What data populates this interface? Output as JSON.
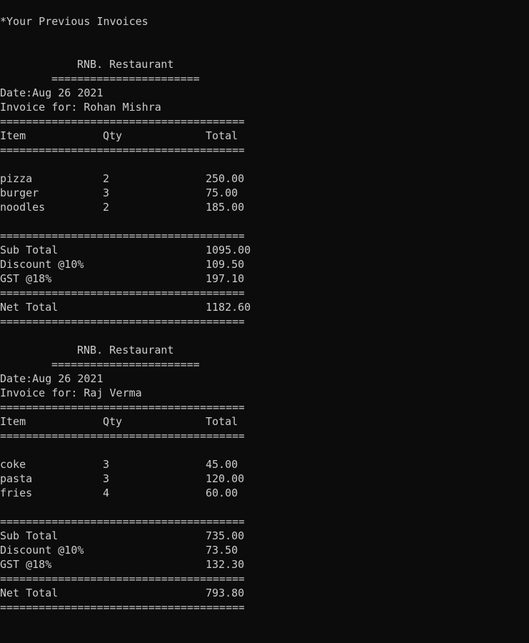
{
  "header": "*Your Previous Invoices",
  "rules": {
    "long": "======================================",
    "short": "======================="
  },
  "invoices": [
    {
      "restaurant": "RNB. Restaurant",
      "date": "Date:Aug 26 2021",
      "customer": "Invoice for: Rohan Mishra",
      "columns": [
        "Item",
        "Qty",
        "Total"
      ],
      "items": [
        {
          "name": "pizza",
          "qty": "2",
          "total": "250.00"
        },
        {
          "name": "burger",
          "qty": "3",
          "total": "75.00"
        },
        {
          "name": "noodles",
          "qty": "2",
          "total": "185.00"
        }
      ],
      "sub_total": {
        "label": "Sub Total",
        "value": "1095.00"
      },
      "discount": {
        "label": "Discount @10%",
        "value": "109.50"
      },
      "gst": {
        "label": "GST @18%",
        "value": "197.10"
      },
      "net_total": {
        "label": "Net Total",
        "value": "1182.60"
      }
    },
    {
      "restaurant": "RNB. Restaurant",
      "date": "Date:Aug 26 2021",
      "customer": "Invoice for: Raj Verma",
      "columns": [
        "Item",
        "Qty",
        "Total"
      ],
      "items": [
        {
          "name": "coke",
          "qty": "3",
          "total": "45.00"
        },
        {
          "name": "pasta",
          "qty": "3",
          "total": "120.00"
        },
        {
          "name": "fries",
          "qty": "4",
          "total": "60.00"
        }
      ],
      "sub_total": {
        "label": "Sub Total",
        "value": "735.00"
      },
      "discount": {
        "label": "Discount @10%",
        "value": "73.50"
      },
      "gst": {
        "label": "GST @18%",
        "value": "132.30"
      },
      "net_total": {
        "label": "Net Total",
        "value": "793.80"
      }
    }
  ]
}
